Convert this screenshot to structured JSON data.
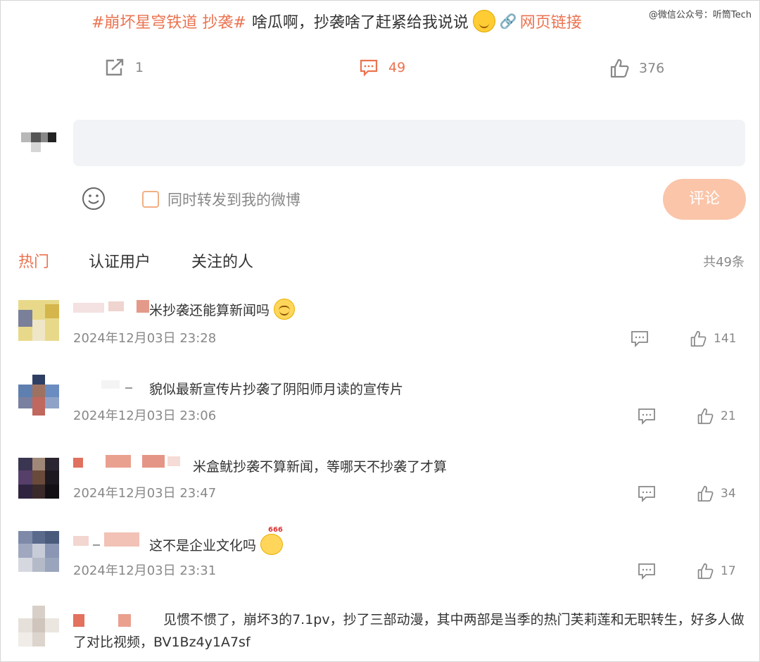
{
  "watermark": "@微信公众号：听筒Tech",
  "post": {
    "hashtag": "#崩坏星穹铁道 抄袭#",
    "text": "啥瓜啊，抄袭啥了赶紧给我说说",
    "link_label": "网页链接",
    "icons": {
      "emoji": "tongue-face-emoji",
      "link": "chain-link-icon"
    }
  },
  "actions": {
    "repost_count": "1",
    "comment_count": "49",
    "like_count": "376",
    "icons": {
      "repost": "share-icon",
      "comment": "comment-icon",
      "like": "thumbs-up-icon"
    }
  },
  "composer": {
    "repost_checkbox_label": "同时转发到我的微博",
    "submit_label": "评论",
    "icons": {
      "emoji": "smiley-icon"
    }
  },
  "tabs": [
    "热门",
    "认证用户",
    "关注的人"
  ],
  "active_tab": 0,
  "total_label": "共49条",
  "comments": [
    {
      "text": "米抄袭还能算新闻吗",
      "time": "2024年12月03日 23:28",
      "likes": "141"
    },
    {
      "text": "貌似最新宣传片抄袭了阴阳师月读的宣传片",
      "time": "2024年12月03日 23:06",
      "likes": "21"
    },
    {
      "text": "米盒鱿抄袭不算新闻，等哪天不抄袭了才算",
      "time": "2024年12月03日 23:47",
      "likes": "34"
    },
    {
      "text": "这不是企业文化吗",
      "time": "2024年12月03日 23:31",
      "likes": "17"
    },
    {
      "text": "见惯不惯了，崩坏3的7.1pv，抄了三部动漫，其中两部是当季的热门芙莉莲和无职转生，好多人做了对比视频，BV1Bz4y1A7sf"
    }
  ],
  "colors": {
    "accent": "#eb7350",
    "submit_bg": "#fbc5a9",
    "input_bg": "#f2f3f6",
    "muted": "#888888"
  }
}
